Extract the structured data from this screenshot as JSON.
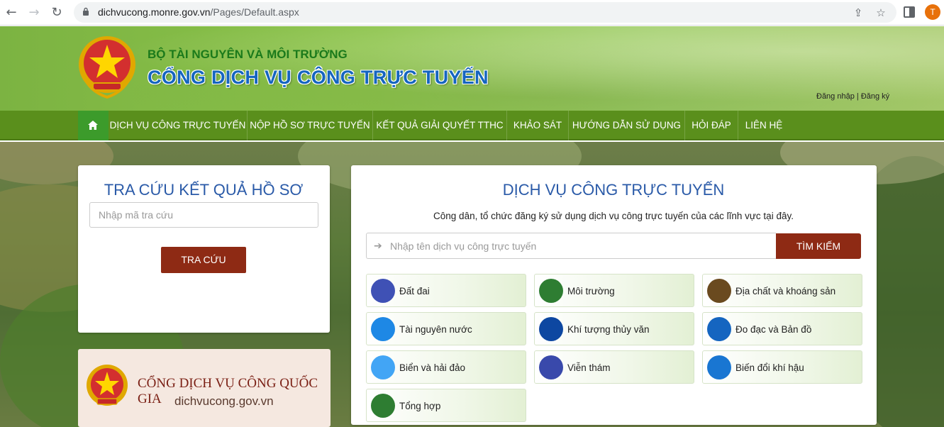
{
  "browser": {
    "url_host": "dichvucong.monre.gov.vn",
    "url_path": "/Pages/Default.aspx",
    "avatar_letter": "T"
  },
  "header": {
    "ministry": "BỘ TÀI NGUYÊN VÀ MÔI TRƯỜNG",
    "portal_title": "CỔNG DỊCH VỤ CÔNG TRỰC TUYẾN",
    "login": "Đăng nhập",
    "separator": " | ",
    "register": "Đăng ký"
  },
  "nav": {
    "home_icon": "home-icon",
    "items": [
      "DỊCH VỤ CÔNG TRỰC TUYẾN",
      "NỘP HỒ SƠ TRỰC TUYẾN",
      "KẾT QUẢ GIẢI QUYẾT TTHC",
      "KHẢO SÁT",
      "HƯỚNG DẪN SỬ DỤNG",
      "HỎI ĐÁP",
      "LIÊN HỆ"
    ]
  },
  "lookup": {
    "title": "TRA CỨU KẾT QUẢ HỒ SƠ",
    "placeholder": "Nhập mã tra cứu",
    "button": "TRA CỨU"
  },
  "national_portal": {
    "title": "CỔNG DỊCH VỤ CÔNG QUỐC GIA",
    "url": "dichvucong.gov.vn"
  },
  "services": {
    "title": "DỊCH VỤ CÔNG TRỰC TUYẾN",
    "subtitle": "Công dân, tổ chức đăng ký sử dụng dịch vụ công trực tuyến của các lĩnh vực tại đây.",
    "search_placeholder": "Nhập tên dịch vụ công trực tuyến",
    "search_button": "TÌM KIẾM",
    "categories": [
      {
        "label": "Đất đai",
        "color": "#3f51b5"
      },
      {
        "label": "Môi trường",
        "color": "#2e7d32"
      },
      {
        "label": "Địa chất và khoáng sản",
        "color": "#6a4a1f"
      },
      {
        "label": "Tài nguyên nước",
        "color": "#1e88e5"
      },
      {
        "label": "Khí tượng thủy văn",
        "color": "#0d47a1"
      },
      {
        "label": "Đo đạc và Bản đồ",
        "color": "#1565c0"
      },
      {
        "label": "Biển và hải đảo",
        "color": "#42a5f5"
      },
      {
        "label": "Viễn thám",
        "color": "#3949ab"
      },
      {
        "label": "Biến đổi khí hậu",
        "color": "#1976d2"
      },
      {
        "label": "Tổng hợp",
        "color": "#2e7d32"
      }
    ]
  }
}
